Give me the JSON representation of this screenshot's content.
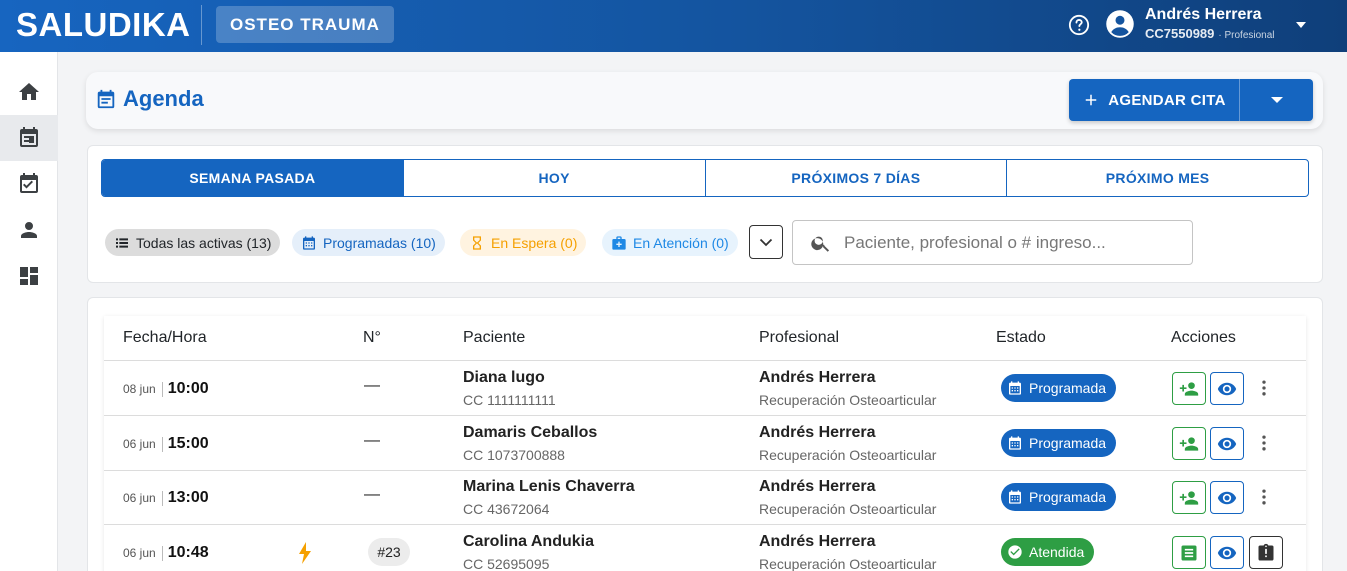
{
  "topbar": {
    "brand": "SALUDIKA",
    "module": "OSTEO TRAUMA",
    "user_name": "Andrés Herrera",
    "user_id": "CC7550989",
    "user_role": "· Profesional"
  },
  "sidebar": {
    "items": [
      {
        "name": "home",
        "icon": "home-icon"
      },
      {
        "name": "agenda",
        "icon": "calendar-icon",
        "active": true
      },
      {
        "name": "tasks",
        "icon": "event-check-icon"
      },
      {
        "name": "patients",
        "icon": "person-icon"
      },
      {
        "name": "dashboard",
        "icon": "dashboard-icon"
      }
    ]
  },
  "header": {
    "title": "Agenda",
    "agendar_label": "AGENDAR CITA"
  },
  "tabs": [
    "SEMANA PASADA",
    "HOY",
    "PRÓXIMOS 7 DÍAS",
    "PRÓXIMO MES"
  ],
  "active_tab": "SEMANA PASADA",
  "filters": {
    "all": "Todas las activas (13)",
    "programadas": "Programadas (10)",
    "espera": "En Espera (0)",
    "atencion": "En Atención (0)"
  },
  "search": {
    "placeholder": "Paciente, profesional o # ingreso...",
    "value": ""
  },
  "table": {
    "headers": {
      "fecha": "Fecha/Hora",
      "numero": "N°",
      "paciente": "Paciente",
      "profesional": "Profesional",
      "estado": "Estado",
      "acciones": "Acciones"
    },
    "rows": [
      {
        "date": "08 jun",
        "time": "10:00",
        "num": "—",
        "patient": "Diana lugo",
        "patient_id": "CC 1111111111",
        "pro": "Andrés Herrera",
        "specialty": "Recuperación Osteoarticular",
        "status": "Programada"
      },
      {
        "date": "06 jun",
        "time": "15:00",
        "num": "—",
        "patient": "Damaris Ceballos",
        "patient_id": "CC 1073700888",
        "pro": "Andrés Herrera",
        "specialty": "Recuperación Osteoarticular",
        "status": "Programada"
      },
      {
        "date": "06 jun",
        "time": "13:00",
        "num": "—",
        "patient": "Marina Lenis Chaverra",
        "patient_id": "CC 43672064",
        "pro": "Andrés Herrera",
        "specialty": "Recuperación Osteoarticular",
        "status": "Programada"
      },
      {
        "date": "06 jun",
        "time": "10:48",
        "num": "#23",
        "patient": "Carolina Andukia",
        "patient_id": "CC 52695095",
        "pro": "Andrés Herrera",
        "specialty": "Recuperación Osteoarticular",
        "status": "Atendida"
      }
    ]
  },
  "colors": {
    "primary": "#1565c0",
    "success": "#2e9e44",
    "warning": "#f5a000",
    "info": "#1e88e5"
  }
}
